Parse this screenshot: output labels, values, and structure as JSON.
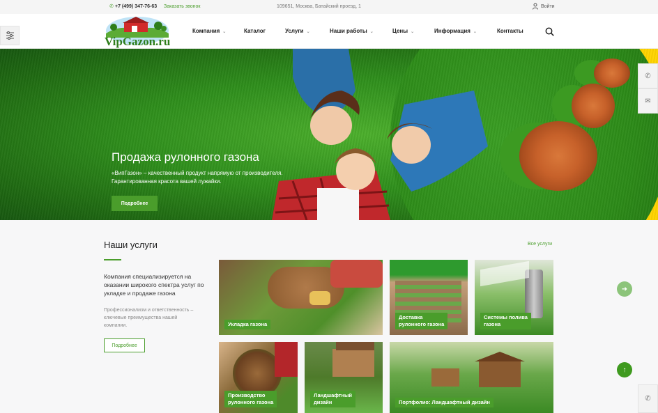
{
  "topbar": {
    "phone": "+7 (499) 347-76-63",
    "callback": "Заказать звонок",
    "address": "109651, Москва, Батайский проезд, 1",
    "login": "Войти"
  },
  "header": {
    "logo_text": "VipGazon.ru",
    "nav": [
      {
        "label": "Компания",
        "dropdown": true
      },
      {
        "label": "Каталог",
        "dropdown": false
      },
      {
        "label": "Услуги",
        "dropdown": true
      },
      {
        "label": "Наши работы",
        "dropdown": true
      },
      {
        "label": "Цены",
        "dropdown": true
      },
      {
        "label": "Информация",
        "dropdown": true
      },
      {
        "label": "Контакты",
        "dropdown": false
      }
    ]
  },
  "hero": {
    "title": "Продажа рулонного газона",
    "description": "«ВипГазон» – качественный продукт напрямую от производителя. Гарантированная красота вашей лужайки.",
    "button": "Подробнее"
  },
  "services": {
    "title": "Наши услуги",
    "all_link": "Все услуги",
    "lead": "Компания специализируется на оказании широкого спектра услуг по укладке и продаже газона",
    "sub": "Профессионализм и ответственность – ключевые преимущества нашей компании.",
    "button": "Подробнее",
    "cards": [
      {
        "label": [
          "Укладка газона"
        ]
      },
      {
        "label": [
          "Доставка",
          "рулонного газона"
        ]
      },
      {
        "label": [
          "Системы полива",
          "газона"
        ]
      },
      {
        "label": [
          "Производство",
          "рулонного газона"
        ]
      },
      {
        "label": [
          "Ландшафтный",
          "дизайн"
        ]
      },
      {
        "label": [
          "Портфолио: Ландшафтный дизайн"
        ]
      }
    ]
  },
  "icons": {
    "settings": "sliders-icon",
    "phone": "phone-icon",
    "mail": "mail-icon",
    "search": "search-icon",
    "user": "user-icon",
    "arrow_right": "arrow-right-icon",
    "arrow_up": "arrow-up-icon"
  },
  "colors": {
    "accent": "#4a9d2b",
    "hero_yellow": "#ffd400"
  }
}
